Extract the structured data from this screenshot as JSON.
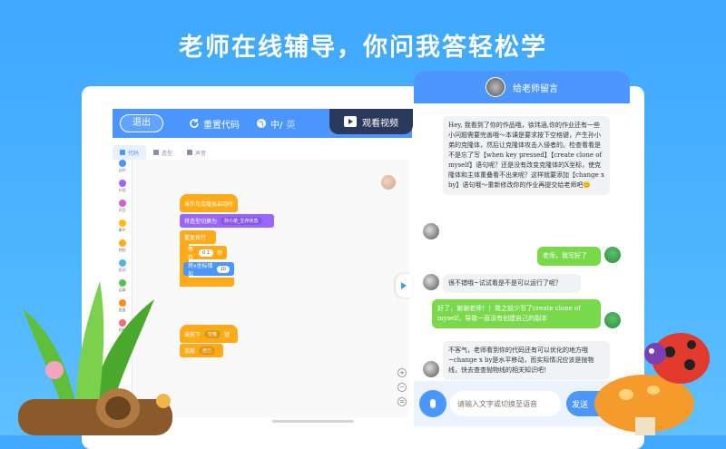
{
  "headline": "老师在线辅导，你问我答轻松学",
  "editor": {
    "exit_label": "退出",
    "reset_label": "重置代码",
    "lang_label": "中/",
    "lang_alt": "英",
    "video_label": "观看视频",
    "tabs": [
      {
        "label": "代码"
      },
      {
        "label": "造型"
      },
      {
        "label": "声音"
      }
    ],
    "categories": [
      {
        "label": "动作",
        "color": "#4c97ff"
      },
      {
        "label": "外观",
        "color": "#9966ff"
      },
      {
        "label": "声音",
        "color": "#cf63cf"
      },
      {
        "label": "事件",
        "color": "#ffbf00"
      },
      {
        "label": "控制",
        "color": "#ffab19"
      },
      {
        "label": "侦测",
        "color": "#5cb1d6"
      },
      {
        "label": "运算",
        "color": "#59c059"
      },
      {
        "label": "变量",
        "color": "#ff8c1a"
      },
      {
        "label": "自制",
        "color": "#ff6680"
      }
    ],
    "blocks": {
      "hat1": "当作为克隆体启动时",
      "switch_costume": "将造型切换为",
      "costume_value": "孙小弟_生存状态",
      "forever": "重复执行",
      "wait": "等待",
      "wait_value": "0.1",
      "wait_unit": "秒",
      "change_x": "将x坐标增加",
      "change_x_value": "10",
      "hat2": "当按下",
      "key_value": "空格",
      "key_suffix": "键",
      "clone": "克隆",
      "clone_value": "自己"
    }
  },
  "chat": {
    "title": "给老师留言",
    "messages": [
      {
        "from": "teacher",
        "text": "Hey, 我看到了你的作品哦，徐玮涵,你的作业还有一些小问题需要完善哦～本课是要求按下空格键，产生孙小弟的克隆体，然后让克隆体攻击入侵者的。检查看看是不是忘了写【when key pressed】【create clone of myself】语句呢？还是没有改变克隆体的X坐标，使克隆体和主体重叠看不出来呢？这样就要添加【change x by】语句哦～重新修改你的作业再提交给老师吧😊"
      },
      {
        "from": "student",
        "text": "老师，我写好了"
      },
      {
        "from": "teacher",
        "text": "很不错哦~试试看是不是可以运行了呢？"
      },
      {
        "from": "student",
        "text": "好了，谢谢老师！！我之前少写了create clone of myself，导致一直没有创建自己的副本"
      },
      {
        "from": "teacher",
        "text": "不客气，老师看到你的代码还有可以优化的地方哦~change x by是水平移动，而实际情况应该是抛物线，快去查查抛物线的相关知识吧！"
      }
    ],
    "input_placeholder": "请输入文字或切换至语音",
    "send_label": "发送"
  }
}
